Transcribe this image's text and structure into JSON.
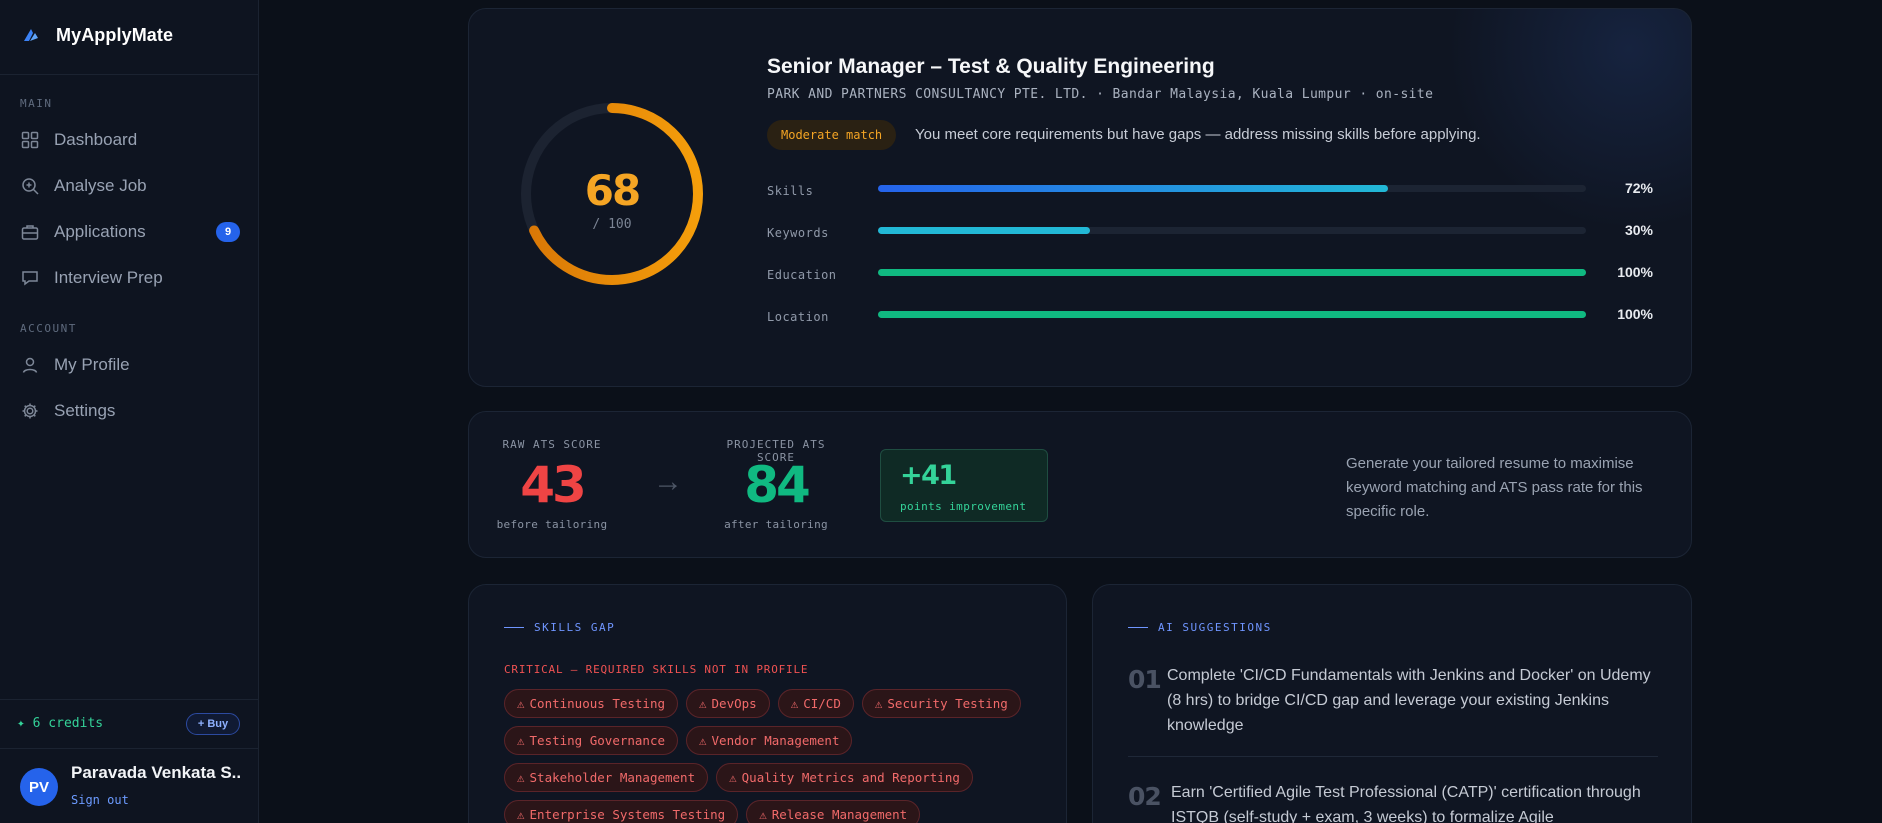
{
  "app": {
    "name": "MyApplyMate"
  },
  "sidebar": {
    "main_label": "MAIN",
    "account_label": "ACCOUNT",
    "main_items": [
      {
        "label": "Dashboard",
        "icon": "grid-icon"
      },
      {
        "label": "Analyse Job",
        "icon": "search-plus-icon"
      },
      {
        "label": "Applications",
        "icon": "briefcase-icon",
        "badge": "9"
      },
      {
        "label": "Interview Prep",
        "icon": "chat-icon"
      }
    ],
    "account_items": [
      {
        "label": "My Profile",
        "icon": "user-icon"
      },
      {
        "label": "Settings",
        "icon": "gear-icon"
      }
    ],
    "credits": "✦ 6 credits",
    "buy_label": "+ Buy",
    "user": {
      "initials": "PV",
      "name": "Paravada Venkata S...",
      "sign_out": "Sign out"
    }
  },
  "job": {
    "score": "68",
    "score_value": 68,
    "score_max": "/ 100",
    "title": "Senior Manager – Test & Quality Engineering",
    "company_line": "PARK AND PARTNERS CONSULTANCY PTE. LTD. · Bandar Malaysia, Kuala Lumpur · on-site",
    "match_badge": "Moderate match",
    "match_desc": "You meet core requirements but have gaps — address missing skills before applying.",
    "bars": [
      {
        "label": "Skills",
        "pct": "72%",
        "value": 72,
        "color": "#2563eb",
        "color2": "#22b8d6"
      },
      {
        "label": "Keywords",
        "pct": "30%",
        "value": 30,
        "color": "#22b8d6",
        "color2": "#22b8d6"
      },
      {
        "label": "Education",
        "pct": "100%",
        "value": 100,
        "color": "#10b981",
        "color2": "#10b981"
      },
      {
        "label": "Location",
        "pct": "100%",
        "value": 100,
        "color": "#10b981",
        "color2": "#10b981"
      }
    ]
  },
  "ats": {
    "raw_label": "RAW ATS SCORE",
    "raw_score": "43",
    "raw_sub": "before tailoring",
    "projected_label": "PROJECTED ATS SCORE",
    "projected_score": "84",
    "projected_sub": "after tailoring",
    "improvement": "+41",
    "improvement_sub": "points improvement",
    "description": "Generate your tailored resume to maximise keyword matching and ATS pass rate for this specific role.",
    "colors": {
      "raw": "#ef4444",
      "projected": "#10b981"
    }
  },
  "skills_gap": {
    "heading": "SKILLS GAP",
    "critical_label": "CRITICAL — REQUIRED SKILLS NOT IN PROFILE",
    "chips": [
      "Continuous Testing",
      "DevOps",
      "CI/CD",
      "Security Testing",
      "Testing Governance",
      "Vendor Management",
      "Stakeholder Management",
      "Quality Metrics and Reporting",
      "Enterprise Systems Testing",
      "Release Management"
    ]
  },
  "ai_suggestions": {
    "heading": "AI SUGGESTIONS",
    "items": [
      {
        "num": "01",
        "text": "Complete 'CI/CD Fundamentals with Jenkins and Docker' on Udemy (8 hrs) to bridge CI/CD gap and leverage your existing Jenkins knowledge"
      },
      {
        "num": "02",
        "text": "Earn 'Certified Agile Test Professional (CATP)' certification through ISTQB (self-study + exam, 3 weeks) to formalize Agile"
      }
    ]
  }
}
